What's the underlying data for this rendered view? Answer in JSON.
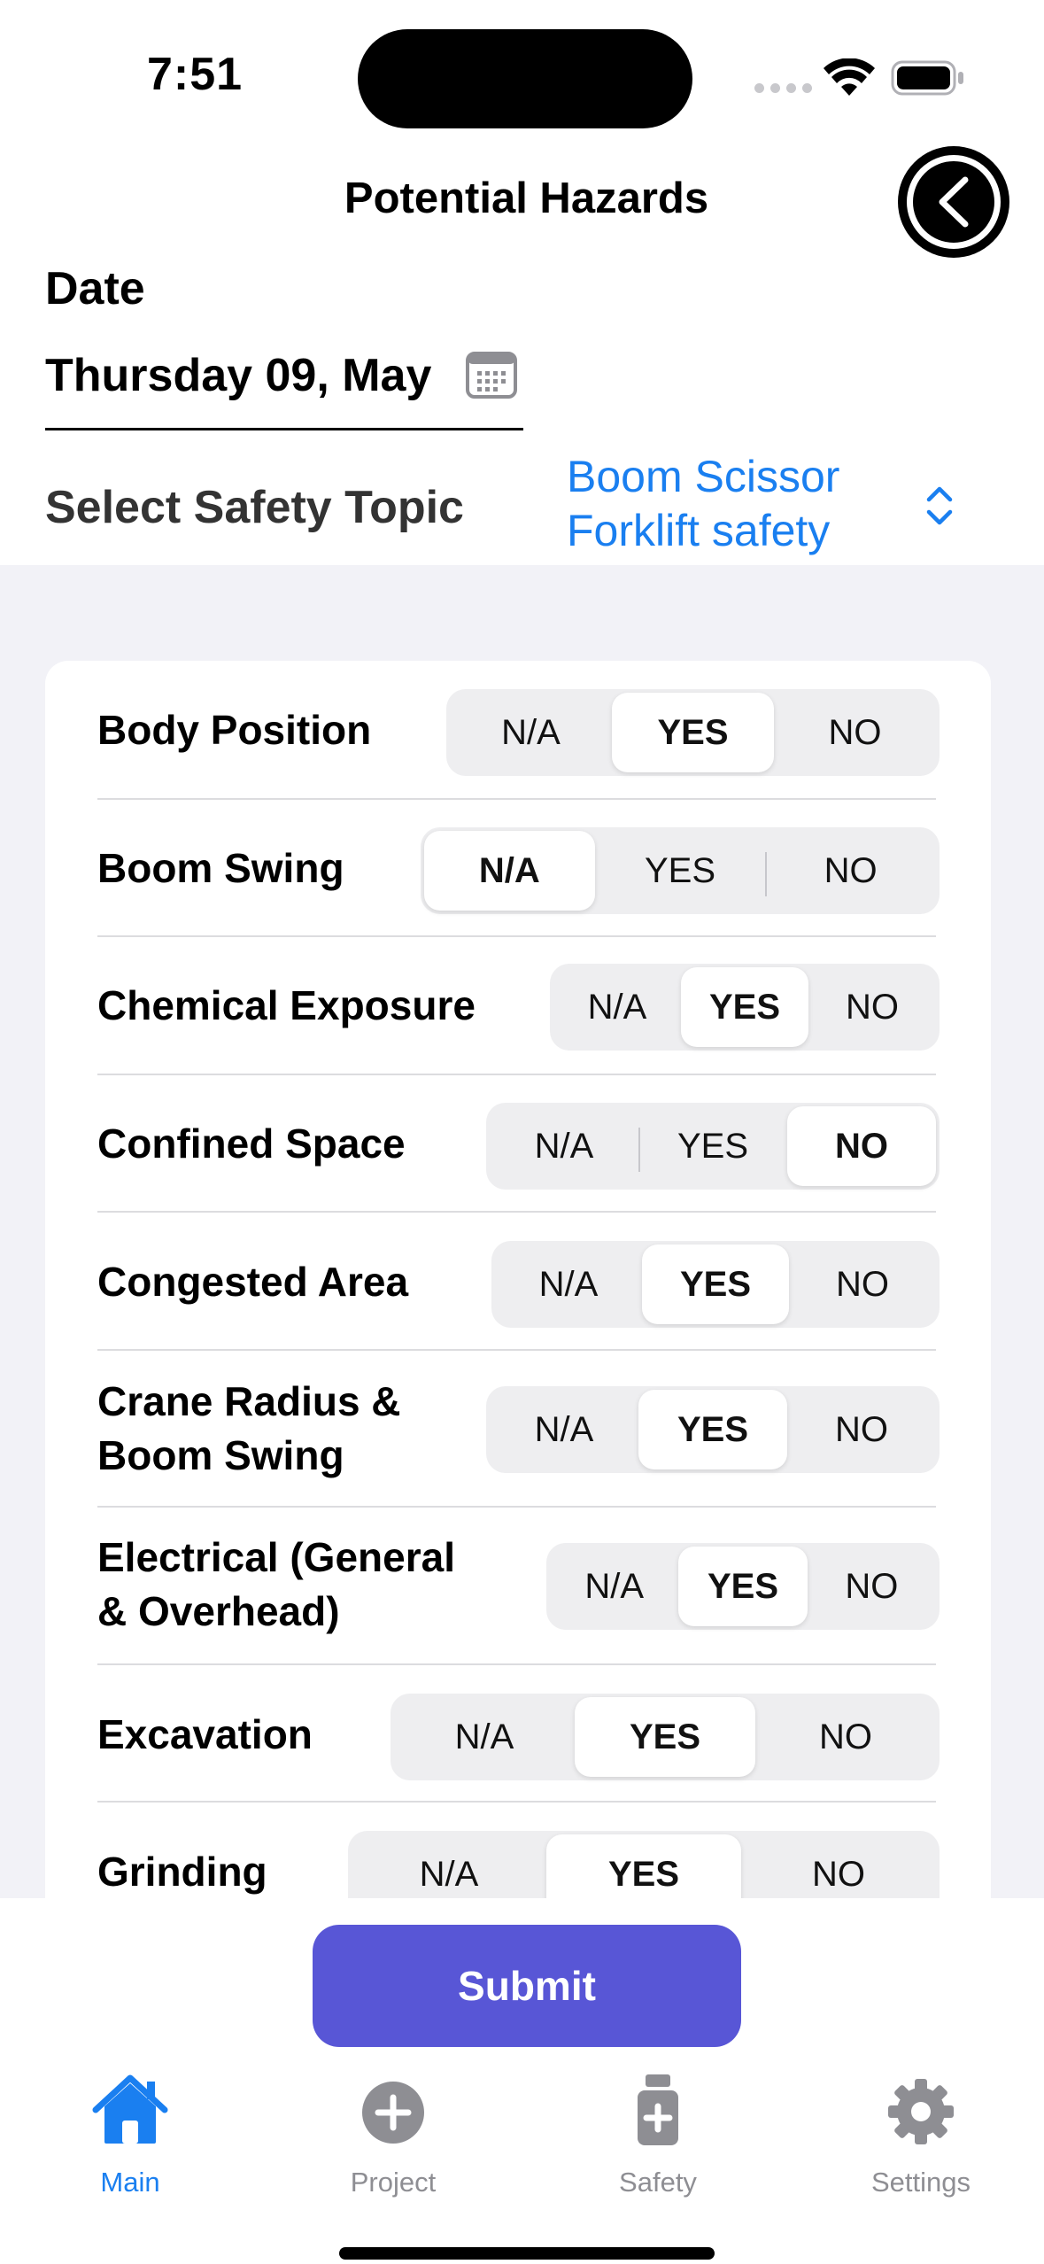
{
  "status_bar": {
    "time": "7:51"
  },
  "header": {
    "title": "Potential Hazards"
  },
  "date": {
    "label": "Date",
    "value": "Thursday 09, May"
  },
  "safety_topic": {
    "label": "Select Safety Topic",
    "selected_line1": "Boom Scissor",
    "selected_line2": "Forklift safety"
  },
  "hazards": [
    {
      "label": "Body Position",
      "options": [
        "N/A",
        "YES",
        "NO"
      ],
      "selected": "YES"
    },
    {
      "label": "Boom Swing",
      "options": [
        "N/A",
        "YES",
        "NO"
      ],
      "selected": "N/A"
    },
    {
      "label": "Chemical Exposure",
      "options": [
        "N/A",
        "YES",
        "NO"
      ],
      "selected": "YES"
    },
    {
      "label": "Confined Space",
      "options": [
        "N/A",
        "YES",
        "NO"
      ],
      "selected": "NO"
    },
    {
      "label": "Congested Area",
      "options": [
        "N/A",
        "YES",
        "NO"
      ],
      "selected": "YES"
    },
    {
      "label_line1": "Crane Radius &",
      "label_line2": "Boom Swing",
      "options": [
        "N/A",
        "YES",
        "NO"
      ],
      "selected": "YES"
    },
    {
      "label_line1": "Electrical (General",
      "label_line2": "& Overhead)",
      "options": [
        "N/A",
        "YES",
        "NO"
      ],
      "selected": "YES"
    },
    {
      "label": "Excavation",
      "options": [
        "N/A",
        "YES",
        "NO"
      ],
      "selected": "YES"
    },
    {
      "label": "Grinding",
      "options": [
        "N/A",
        "YES",
        "NO"
      ],
      "selected": "YES"
    }
  ],
  "submit_label": "Submit",
  "tabs": [
    {
      "label": "Main",
      "icon": "house-icon",
      "active": true
    },
    {
      "label": "Project",
      "icon": "plus-circle-icon",
      "active": false
    },
    {
      "label": "Safety",
      "icon": "medicine-bottle-icon",
      "active": false
    },
    {
      "label": "Settings",
      "icon": "gear-icon",
      "active": false
    }
  ],
  "colors": {
    "accent": "#1a7ff0",
    "submit": "#5856d6",
    "list_background": "#f2f2f7"
  }
}
